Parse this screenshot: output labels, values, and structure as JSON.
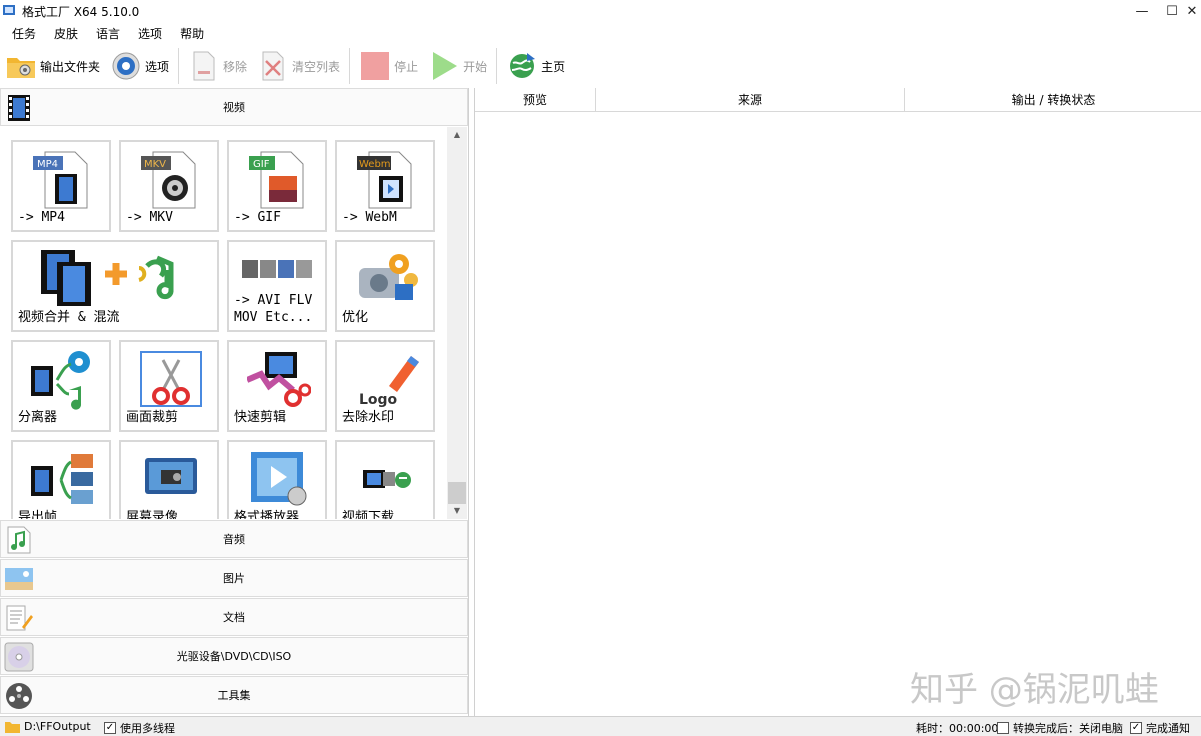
{
  "window": {
    "title": "格式工厂 X64 5.10.0",
    "minimize_glyph": "—",
    "maximize_glyph": "☐",
    "close_glyph": "✕"
  },
  "menu": [
    "任务",
    "皮肤",
    "语言",
    "选项",
    "帮助"
  ],
  "toolbar": {
    "output_folder": "输出文件夹",
    "options": "选项",
    "remove": "移除",
    "clear_list": "清空列表",
    "stop": "停止",
    "start": "开始",
    "home": "主页"
  },
  "left": {
    "video_category": "视频",
    "tiles": [
      {
        "label": "-> MP4",
        "badge": "MP4",
        "badge_color": "#4a73b8"
      },
      {
        "label": "-> MKV",
        "badge": "MKV",
        "badge_color": "#555555"
      },
      {
        "label": "-> GIF",
        "badge": "GIF",
        "badge_color": "#3aa04f"
      },
      {
        "label": "-> WebM",
        "badge": "Webm",
        "badge_color": "#e39a1c"
      },
      {
        "label": "视频合并 & 混流"
      },
      {
        "label": "-> AVI FLV\nMOV Etc..."
      },
      {
        "label": "优化"
      },
      {
        "label": "分离器"
      },
      {
        "label": "画面裁剪"
      },
      {
        "label": "快速剪辑"
      },
      {
        "label": "去除水印",
        "logo_text": "Logo"
      },
      {
        "label": "导出帧"
      },
      {
        "label": "屏幕录像"
      },
      {
        "label": "格式播放器"
      },
      {
        "label": "视频下载"
      }
    ],
    "categories": [
      "音频",
      "图片",
      "文档",
      "光驱设备\\DVD\\CD\\ISO",
      "工具集"
    ],
    "scroll_up": "▲",
    "scroll_down": "▼"
  },
  "right": {
    "columns": [
      "预览",
      "来源",
      "输出 / 转换状态"
    ]
  },
  "watermark": "知乎 @锅泥叽蛙",
  "status": {
    "output_path": "D:\\FFOutput",
    "multithread": "使用多线程",
    "elapsed": "耗时：00:00:00",
    "after_done": "转换完成后：关闭电脑",
    "notify": "完成通知",
    "check_mark": "✓"
  },
  "colors": {
    "accent_blue": "#2d6fc4",
    "stop_red": "#f0a0a0",
    "start_green": "#9ddc8a"
  }
}
